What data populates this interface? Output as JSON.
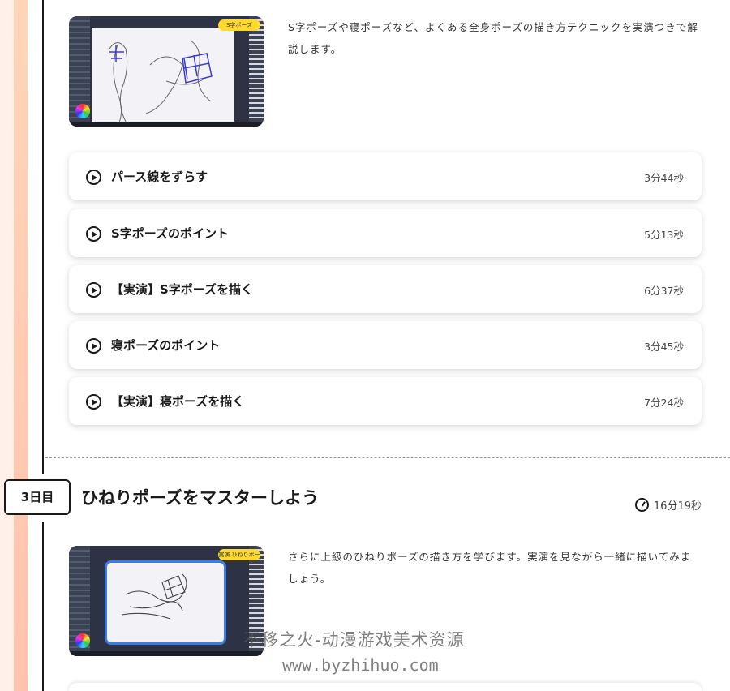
{
  "section_day2": {
    "description": "S字ポーズや寝ポーズなど、よくある全身ポーズの描き方テクニックを実演つきで解説します。",
    "thumbnail_badge": "S字ポーズ",
    "lessons": [
      {
        "title": "パース線をずらす",
        "duration": "3分44秒"
      },
      {
        "title": "S字ポーズのポイント",
        "duration": "5分13秒"
      },
      {
        "title": "【実演】S字ポーズを描く",
        "duration": "6分37秒"
      },
      {
        "title": "寝ポーズのポイント",
        "duration": "3分45秒"
      },
      {
        "title": "【実演】寝ポーズを描く",
        "duration": "7分24秒"
      }
    ]
  },
  "section_day3": {
    "day_label": "3日目",
    "title": "ひねりポーズをマスターしよう",
    "total_duration": "16分19秒",
    "description": "さらに上級のひねりポーズの描き方を学びます。実演を見ながら一緒に描いてみましょう。",
    "thumbnail_badge": "実演 ひねりポーズ"
  },
  "watermark": {
    "line1": "不移之火-动漫游戏美术资源",
    "line2": "www.byzhihuo.com"
  },
  "colors": {
    "stripe_pink": "#fff1ea",
    "stripe_peach": "#ffc9b0",
    "badge_yellow": "#ffd92e",
    "text": "#1a1a1a"
  },
  "icons": {
    "play": "play-circle-icon",
    "clock": "clock-icon"
  }
}
